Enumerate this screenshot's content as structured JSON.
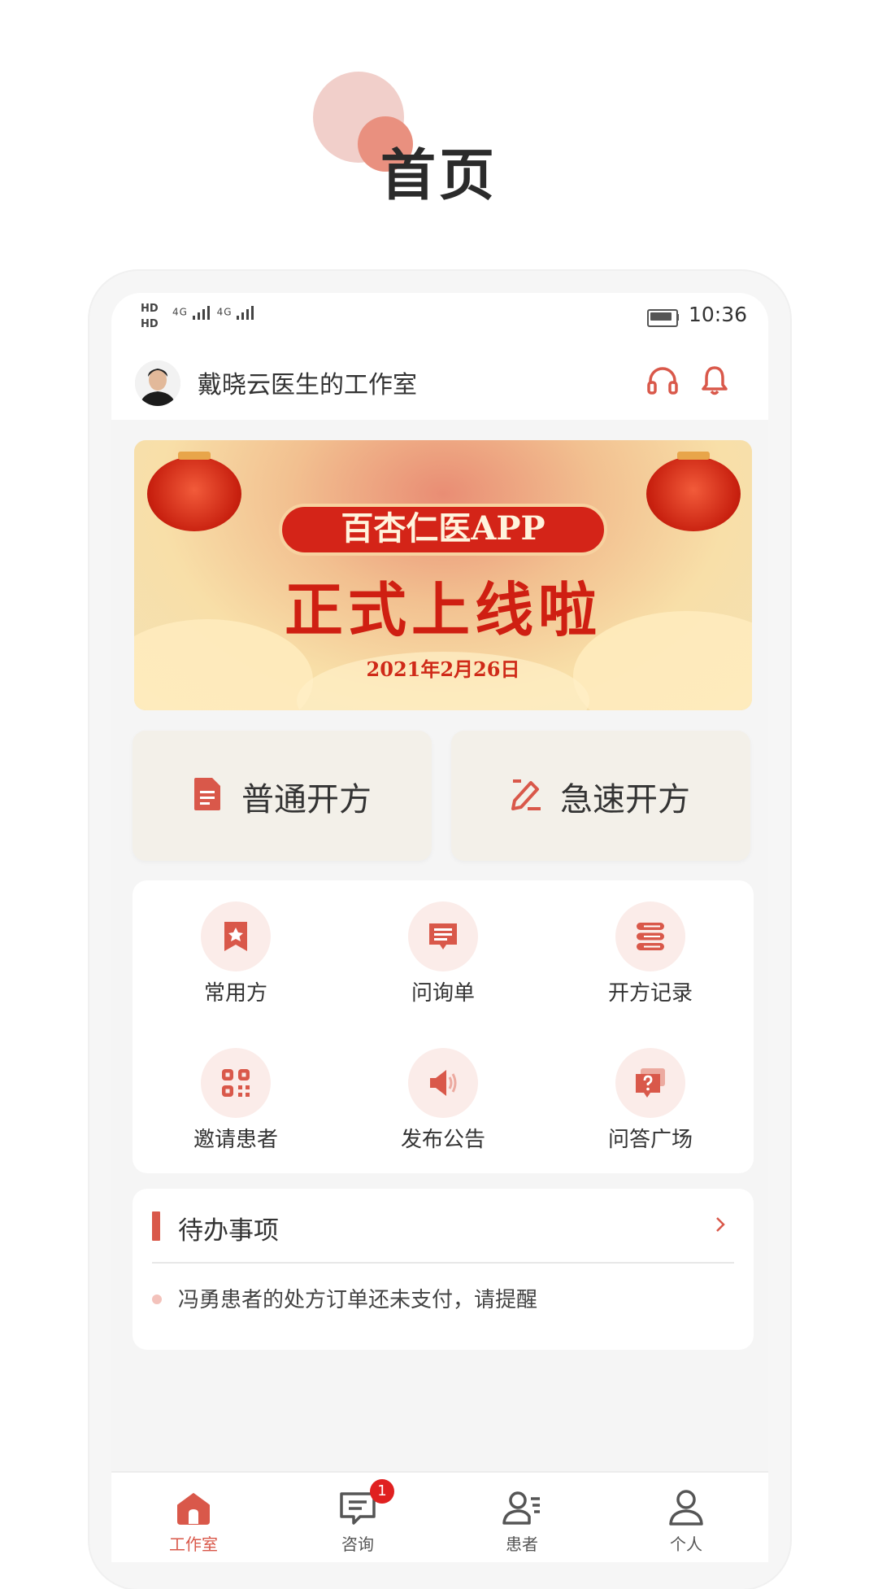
{
  "page_title": "首页",
  "status_bar": {
    "sim1": "HD",
    "sim2": "HD",
    "network1": "4G",
    "network2": "4G",
    "time": "10:36"
  },
  "header": {
    "studio_name": "戴晓云医生的工作室",
    "icons": [
      "headset-icon",
      "bell-icon"
    ]
  },
  "banner": {
    "pill_text": "百杏仁医APP",
    "headline": "正式上线啦",
    "date": "2021年2月26日"
  },
  "prescription_buttons": [
    {
      "label": "普通开方",
      "icon": "document-icon"
    },
    {
      "label": "急速开方",
      "icon": "edit-icon"
    }
  ],
  "quick_grid": [
    {
      "label": "常用方",
      "icon": "bookmark-star-icon"
    },
    {
      "label": "问询单",
      "icon": "message-form-icon"
    },
    {
      "label": "开方记录",
      "icon": "list-icon"
    },
    {
      "label": "邀请患者",
      "icon": "qrcode-icon"
    },
    {
      "label": "发布公告",
      "icon": "speaker-icon"
    },
    {
      "label": "问答广场",
      "icon": "question-icon"
    }
  ],
  "todo": {
    "title": "待办事项",
    "items": [
      "冯勇患者的处方订单还未支付，请提醒"
    ]
  },
  "tabbar": {
    "tabs": [
      {
        "label": "工作室",
        "icon": "home-icon",
        "active": true
      },
      {
        "label": "咨询",
        "icon": "chat-icon",
        "badge": "1"
      },
      {
        "label": "患者",
        "icon": "patients-icon"
      },
      {
        "label": "个人",
        "icon": "person-icon"
      }
    ]
  },
  "colors": {
    "accent": "#d9584a",
    "card_bg": "#f3f0e9",
    "icon_bg": "#fbece9"
  }
}
